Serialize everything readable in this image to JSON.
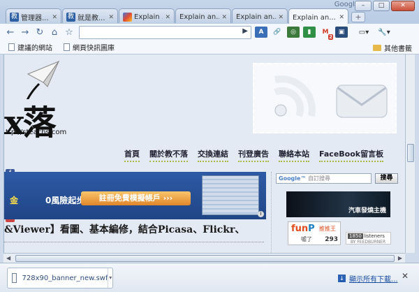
{
  "window": {
    "brand": "Google",
    "controls": {
      "minimize": "–",
      "maximize": "□",
      "close": "✕"
    }
  },
  "tabs": [
    {
      "title": "管理器...",
      "favicon": "teach-favicon",
      "active": false
    },
    {
      "title": "就是教...",
      "favicon": "teach-favicon",
      "active": false
    },
    {
      "title": "Explain ...",
      "favicon": "google-favicon",
      "active": false
    },
    {
      "title": "Explain an...",
      "favicon": "page-favicon",
      "active": false
    },
    {
      "title": "Explain an...",
      "favicon": "page-favicon",
      "active": false
    },
    {
      "title": "Explain an...",
      "favicon": "page-favicon",
      "active": true
    }
  ],
  "toolbar": {
    "back": "←",
    "forward": "→",
    "reload": "↻",
    "home": "⌂",
    "star": "☆",
    "url": "",
    "go": "▶",
    "extensions": [
      "A",
      "🔗",
      "◎",
      "▮",
      "M",
      "▣"
    ],
    "gmail_badge": "2",
    "page_menu": "▭▾",
    "wrench_menu": "🔧▾"
  },
  "bookmarks": {
    "items": [
      "建議的網站",
      "網頁快訊圖庫"
    ],
    "other": "其他書籤"
  },
  "page": {
    "logo_word": "x落",
    "logo_url": "ttp://steachs com",
    "nav": [
      "首頁",
      "關於教不落",
      "交換連結",
      "刊登廣告",
      "聯絡本站",
      "FaceBook留言板"
    ],
    "banner": {
      "text_a": "金",
      "text_b": "0風險起步",
      "button": "註冊免費模擬帳戶 ›››",
      "info": "i"
    },
    "article_title": "&Viewer】看圖、基本編修，結合Picasa、Flickr、",
    "search": {
      "brand": "Google™",
      "placeholder": "自訂搜尋",
      "button": "搜尋"
    },
    "car_ad": "汽車發燒主機",
    "funp": {
      "logo": "fun",
      "logo_p": "P",
      "sub": "推推王",
      "label": "噓了",
      "count": "293"
    },
    "feedburner": {
      "count": "1850",
      "label": "listeners",
      "by": "BY FEEDBURNER"
    }
  },
  "downloads": {
    "file": "728x90_banner_new.swf",
    "show_all": "顯示所有下載...",
    "close": "✕"
  },
  "colors": {
    "accent": "#4a6d9a",
    "tab_bar": "#c6d6ea",
    "page_bg": "#e4eaf3",
    "gmail_red": "#d23b2b"
  }
}
